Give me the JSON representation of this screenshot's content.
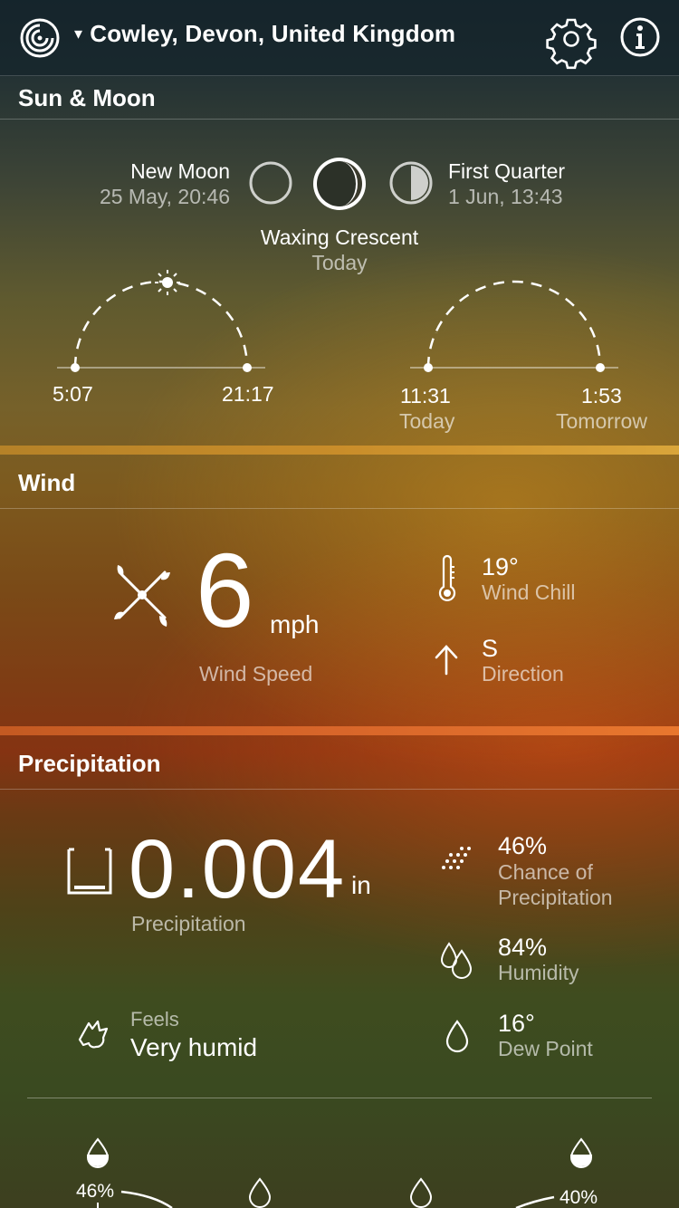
{
  "header": {
    "location": "Cowley, Devon, United Kingdom",
    "caret": "▾",
    "icons": [
      "app-logo-icon",
      "gear-icon",
      "info-icon"
    ]
  },
  "sun_moon": {
    "title": "Sun & Moon",
    "prev_phase": {
      "name": "New Moon",
      "date": "25 May, 20:46"
    },
    "next_phase": {
      "name": "First Quarter",
      "date": "1 Jun, 13:43"
    },
    "current_phase": {
      "name": "Waxing Crescent",
      "when": "Today"
    },
    "sun": {
      "rise": "5:07",
      "set": "21:17"
    },
    "moon": {
      "rise": "11:31",
      "rise_day": "Today",
      "set": "1:53",
      "set_day": "Tomorrow"
    }
  },
  "wind": {
    "title": "Wind",
    "speed": "6",
    "unit": "mph",
    "speed_label": "Wind Speed",
    "chill_value": "19°",
    "chill_label": "Wind Chill",
    "direction_value": "S",
    "direction_label": "Direction"
  },
  "precipitation": {
    "title": "Precipitation",
    "amount": "0.004",
    "unit": "in",
    "amount_label": "Precipitation",
    "feels_label": "Feels",
    "feels_value": "Very humid",
    "chance_value": "46%",
    "chance_label_1": "Chance of",
    "chance_label_2": "Precipitation",
    "humidity_value": "84%",
    "humidity_label": "Humidity",
    "dew_value": "16°",
    "dew_label": "Dew Point",
    "graph_left": "46%",
    "graph_right": "40%"
  },
  "colors": {
    "wind_band": "#c98d2a",
    "precip_band": "#d8662a"
  }
}
